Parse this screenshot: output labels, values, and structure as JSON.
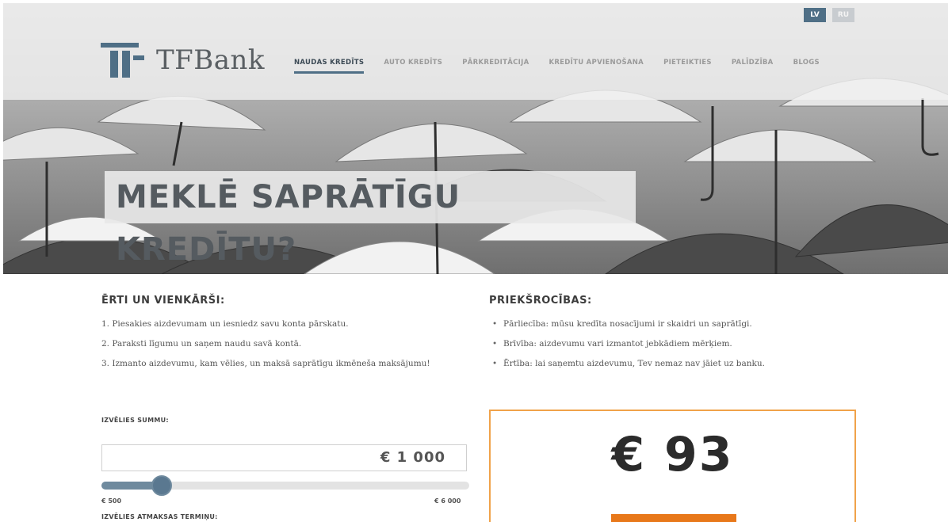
{
  "language": {
    "lv": "LV",
    "ru": "RU"
  },
  "brand": {
    "name": "TFBank"
  },
  "nav": [
    {
      "label": "NAUDAS KREDĪTS",
      "active": true
    },
    {
      "label": "AUTO KREDĪTS"
    },
    {
      "label": "PĀRKREDITĀCIJA"
    },
    {
      "label": "KREDĪTU APVIENOŠANA"
    },
    {
      "label": "PIETEIKTIES"
    },
    {
      "label": "PALĪDZĪBA"
    },
    {
      "label": "BLOGS"
    }
  ],
  "hero": {
    "headline": "MEKLĒ SAPRĀTĪGU KREDĪTU?"
  },
  "steps": {
    "title": "ĒRTI UN VIENKĀRŠI:",
    "items": [
      "1. Piesakies aizdevumam un iesniedz savu konta pārskatu.",
      "2. Paraksti līgumu un saņem naudu savā kontā.",
      "3. Izmanto aizdevumu, kam vēlies, un maksā saprātīgu ikmēneša maksājumu!"
    ]
  },
  "benefits": {
    "title": "PRIEKŠROCĪBAS:",
    "items": [
      "Pārliecība: mūsu kredīta nosacījumi ir skaidri un saprātīgi.",
      "Brīvība: aizdevumu vari izmantot jebkādiem mērķiem.",
      "Ērtība: lai saņemtu aizdevumu, Tev nemaz nav jāiet uz banku."
    ]
  },
  "calculator": {
    "amount_label": "IZVĒLIES SUMMU:",
    "amount_value": "€ 1 000",
    "min": "€ 500",
    "max": "€ 6 000",
    "slider_fraction": 0.09,
    "term_label": "IZVĒLIES ATMAKSAS TERMIŅU:",
    "monthly_payment": "€ 93"
  },
  "colors": {
    "accent": "#4f6f86",
    "orange": "#e8781a",
    "result_border": "#f0a24a"
  }
}
